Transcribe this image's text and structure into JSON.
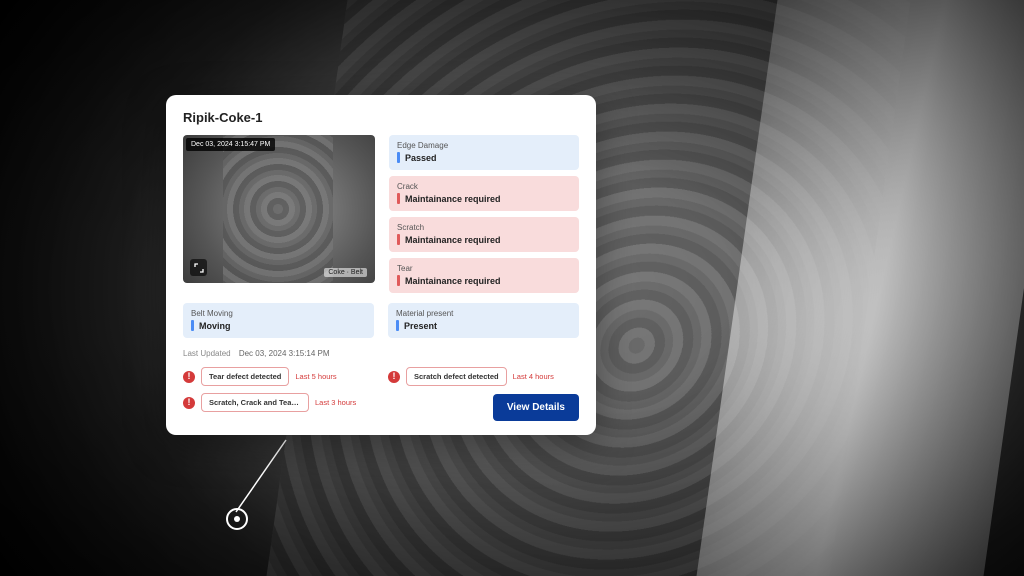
{
  "card": {
    "title": "Ripik-Coke-1",
    "thumbnail": {
      "timestamp": "Dec 03, 2024 3:15:47 PM",
      "caption": "Coke · Belt",
      "expandIcon": "expand-icon"
    },
    "statuses": [
      {
        "label": "Edge Damage",
        "value": "Passed",
        "severity": "ok"
      },
      {
        "label": "Crack",
        "value": "Maintainance required",
        "severity": "warn"
      },
      {
        "label": "Scratch",
        "value": "Maintainance required",
        "severity": "warn"
      },
      {
        "label": "Tear",
        "value": "Maintainance required",
        "severity": "warn"
      }
    ],
    "beltMoving": {
      "label": "Belt Moving",
      "value": "Moving",
      "severity": "ok"
    },
    "materialPresent": {
      "label": "Material present",
      "value": "Present",
      "severity": "ok"
    },
    "lastUpdated": {
      "label": "Last Updated",
      "value": "Dec 03, 2024 3:15:14 PM"
    },
    "alertsLeft": [
      {
        "text": "Tear defect detected",
        "time": "Last 5 hours"
      },
      {
        "text": "Scratch, Crack and Tear defect...",
        "time": "Last 3 hours"
      }
    ],
    "alertsRight": [
      {
        "text": "Scratch defect detected",
        "time": "Last 4 hours"
      }
    ],
    "viewDetails": "View Details"
  },
  "colors": {
    "primary": "#0a3b99",
    "okAccent": "#4b8cf5",
    "warnAccent": "#e05a5a",
    "okBg": "#e4eefa",
    "warnBg": "#f9dcdc",
    "alertRed": "#d43a3a"
  }
}
